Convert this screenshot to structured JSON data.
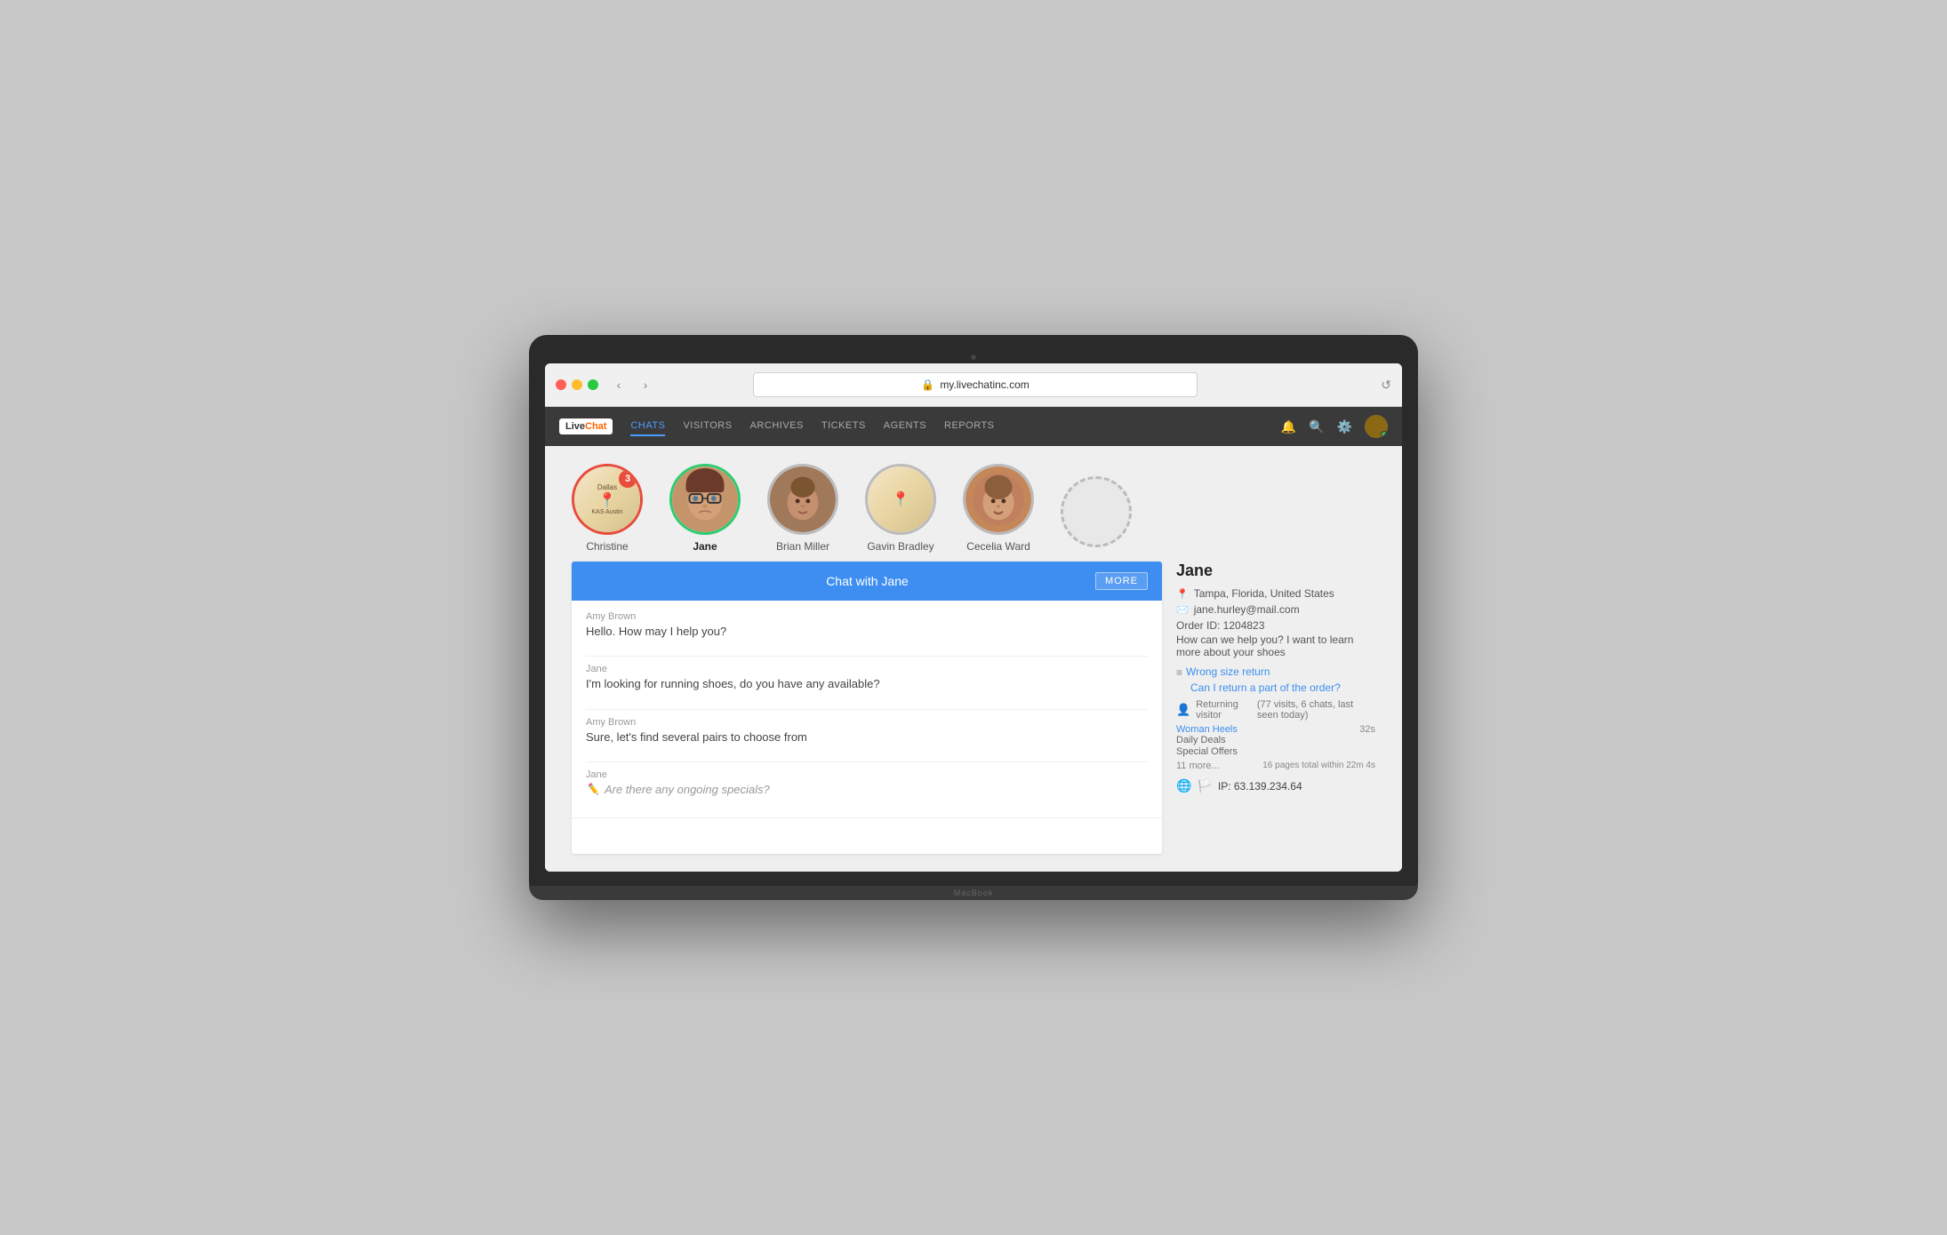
{
  "browser": {
    "url": "my.livechatinc.com",
    "reload_icon": "↺",
    "back_icon": "‹",
    "forward_icon": "›"
  },
  "nav": {
    "logo": "LiveChat",
    "links": [
      "CHATS",
      "VISITORS",
      "ARCHIVES",
      "TICKETS",
      "AGENTS",
      "REPORTS"
    ],
    "active_link": "CHATS"
  },
  "chat_avatars": [
    {
      "name": "Christine",
      "ring": "red",
      "badge": "3",
      "type": "map"
    },
    {
      "name": "Jane",
      "ring": "green",
      "badge": "",
      "type": "person",
      "bold": true
    },
    {
      "name": "Brian Miller",
      "ring": "gray",
      "badge": "",
      "type": "person"
    },
    {
      "name": "Gavin Bradley",
      "ring": "gray",
      "badge": "",
      "type": "map"
    },
    {
      "name": "Cecelia Ward",
      "ring": "gray",
      "badge": "",
      "type": "person"
    },
    {
      "name": "",
      "ring": "dashed",
      "badge": "",
      "type": "empty"
    }
  ],
  "chat": {
    "header": "Chat with Jane",
    "more_btn": "MORE",
    "messages": [
      {
        "sender": "Amy Brown",
        "text": "Hello. How may I help you?",
        "typing": false
      },
      {
        "sender": "Jane",
        "text": "I'm looking for running shoes, do you have any available?",
        "typing": false
      },
      {
        "sender": "Amy Brown",
        "text": "Sure, let's find several pairs to choose from",
        "typing": false
      },
      {
        "sender": "Jane",
        "text": "Are there any ongoing specials?",
        "typing": true
      }
    ],
    "input_placeholder": ""
  },
  "sidebar": {
    "name": "Jane",
    "location": "Tampa, Florida, United States",
    "email": "jane.hurley@mail.com",
    "order_label": "Order ID: 1204823",
    "question": "How can we help you? I want to learn more about your shoes",
    "links": [
      "Wrong size return",
      "Can I return a part of the order?"
    ],
    "returning": "Returning visitor",
    "visits": "(77 visits, 6 chats, last seen today)",
    "pages": [
      {
        "name": "Woman Heels",
        "time": "32s"
      },
      {
        "name": "Daily Deals",
        "time": ""
      },
      {
        "name": "Special Offers",
        "time": ""
      }
    ],
    "more_pages": "11 more...",
    "pages_total": "16 pages total within 22m 4s",
    "ip": "IP: 63.139.234.64"
  }
}
